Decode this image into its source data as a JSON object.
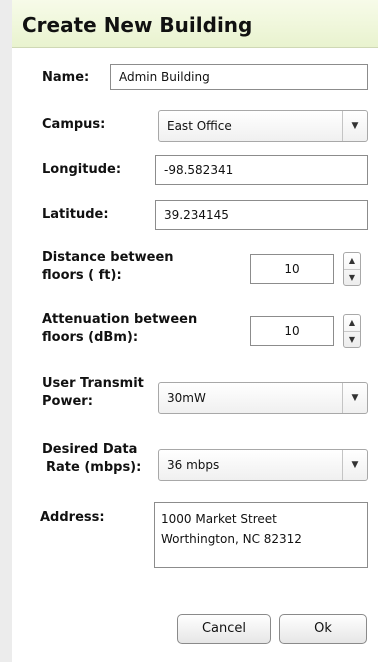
{
  "dialog": {
    "title": "Create New Building"
  },
  "form": {
    "name": {
      "label": "Name:",
      "value": "Admin Building"
    },
    "campus": {
      "label": "Campus:",
      "value": "East Office"
    },
    "longitude": {
      "label": "Longitude:",
      "value": "-98.582341"
    },
    "latitude": {
      "label": "Latitude:",
      "value": "39.234145"
    },
    "floor_distance": {
      "label_line1": "Distance between",
      "label_line2": "floors ( ft):",
      "value": "10"
    },
    "floor_attenuation": {
      "label_line1": "Attenuation between",
      "label_line2": "floors (dBm):",
      "value": "10"
    },
    "transmit_power": {
      "label_line1": "User Transmit",
      "label_line2": "Power:",
      "value": "30mW"
    },
    "data_rate": {
      "label_line1": "Desired Data",
      "label_line2": "Rate (mbps):",
      "value": "36 mbps"
    },
    "address": {
      "label": "Address:",
      "value": "1000 Market Street\nWorthington, NC 82312"
    }
  },
  "buttons": {
    "cancel": "Cancel",
    "ok": "Ok"
  },
  "icons": {
    "dropdown": "chevron-down-icon",
    "spin_up": "chevron-up-icon",
    "spin_down": "chevron-down-icon"
  }
}
